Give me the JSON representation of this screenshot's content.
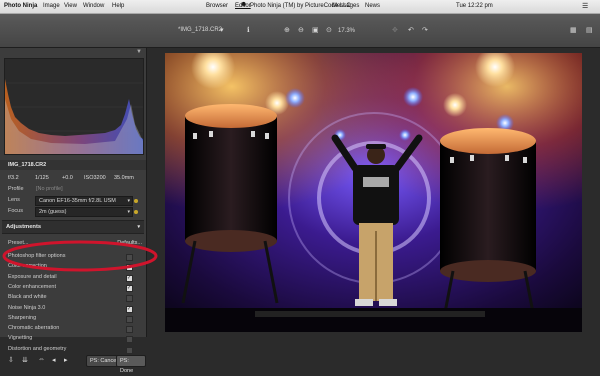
{
  "menubar": {
    "app": "Photo Ninja",
    "items": [
      "Image",
      "View",
      "Window",
      "Help"
    ],
    "tabs": [
      "Browser",
      "Editor"
    ],
    "title": "Photo Ninja (TM) by PictureCode LLC",
    "right": [
      "Messages",
      "News"
    ],
    "clock": "Tue 12:22 pm"
  },
  "toolbar": {
    "file": "*IMG_1718.CR2",
    "zoom": "17.3%"
  },
  "panel": {
    "filename": "IMG_1718.CR2",
    "exif": [
      "f/3.2",
      "1/125",
      "+0.0",
      "ISO3200",
      "35.0mm"
    ],
    "profile_label": "Profile",
    "profile_value": "[No profile]",
    "lens_label": "Lens",
    "lens_value": "Canon EF16-35mm f/2.8L USM",
    "focus_label": "Focus",
    "focus_value": "2m (guess)",
    "adjustments_title": "Adjustments",
    "preset_label": "Preset...",
    "defaults_label": "Defaults...",
    "items": [
      {
        "label": "Photoshop filter options",
        "checked": false
      },
      {
        "label": "Color correction",
        "checked": true
      },
      {
        "label": "Exposure and detail",
        "checked": true
      },
      {
        "label": "Color enhancement",
        "checked": true
      },
      {
        "label": "Black and white",
        "checked": false
      },
      {
        "label": "Noise Ninja 3.0",
        "checked": true
      },
      {
        "label": "Sharpening",
        "checked": false
      },
      {
        "label": "Chromatic aberration",
        "checked": false
      },
      {
        "label": "Vignetting",
        "checked": false
      },
      {
        "label": "Distortion and geometry",
        "checked": false
      }
    ],
    "cancel": "PS: Cancel",
    "done": "PS: Done"
  },
  "colors": {
    "annotation": "#d0142c",
    "accent": "#c9a82a"
  }
}
